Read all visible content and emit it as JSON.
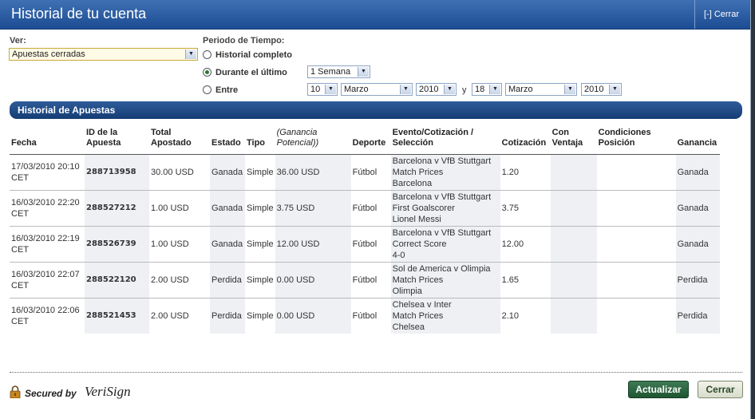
{
  "window": {
    "title": "Historial de tu cuenta",
    "close_label": "[-] Cerrar"
  },
  "filters": {
    "view_label": "Ver:",
    "view_value": "Apuestas cerradas",
    "period_label": "Periodo de Tiempo:",
    "option_all": "Historial completo",
    "option_last": "Durante el último",
    "option_last_value": "1 Semana",
    "option_between": "Entre",
    "between_from_day": "10",
    "between_from_month": "Marzo",
    "between_from_year": "2010",
    "between_and": "y",
    "between_to_day": "18",
    "between_to_month": "Marzo",
    "between_to_year": "2010",
    "selected_option": "option_last"
  },
  "section": {
    "title": "Historial de Apuestas"
  },
  "table": {
    "headers": {
      "fecha": "Fecha",
      "id_1": "ID de la",
      "id_2": "Apuesta",
      "total_1": "Total",
      "total_2": "Apostado",
      "estado": "Estado",
      "tipo": "Tipo",
      "ganancia_pot_1": "(Ganancia",
      "ganancia_pot_2": "Potencial))",
      "deporte": "Deporte",
      "evento_1": "Evento/Cotización /",
      "evento_2": "Selección",
      "cotizacion": "Cotización",
      "ventaja_1": "Con",
      "ventaja_2": "Ventaja",
      "condiciones_1": "Condiciones",
      "condiciones_2": "Posición",
      "ganancia": "Ganancia"
    },
    "rows": [
      {
        "fecha_1": "17/03/2010 20:10",
        "fecha_2": "CET",
        "id": "288713958",
        "total": "30.00 USD",
        "estado": "Ganada",
        "tipo": "Simple",
        "potencial": "36.00 USD",
        "deporte": "Fútbol",
        "evento_1": "Barcelona v VfB Stuttgart",
        "evento_2": "Match Prices",
        "evento_3": "Barcelona",
        "cotizacion": "1.20",
        "ganancia": "Ganada"
      },
      {
        "fecha_1": "16/03/2010 22:20",
        "fecha_2": "CET",
        "id": "288527212",
        "total": "1.00 USD",
        "estado": "Ganada",
        "tipo": "Simple",
        "potencial": "3.75 USD",
        "deporte": "Fútbol",
        "evento_1": "Barcelona v VfB Stuttgart",
        "evento_2": "First Goalscorer",
        "evento_3": "Lionel Messi",
        "cotizacion": "3.75",
        "ganancia": "Ganada"
      },
      {
        "fecha_1": "16/03/2010 22:19",
        "fecha_2": "CET",
        "id": "288526739",
        "total": "1.00 USD",
        "estado": "Ganada",
        "tipo": "Simple",
        "potencial": "12.00 USD",
        "deporte": "Fútbol",
        "evento_1": "Barcelona v VfB Stuttgart",
        "evento_2": "Correct Score",
        "evento_3": "4-0",
        "cotizacion": "12.00",
        "ganancia": "Ganada"
      },
      {
        "fecha_1": "16/03/2010 22:07",
        "fecha_2": "CET",
        "id": "288522120",
        "total": "2.00 USD",
        "estado": "Perdida",
        "tipo": "Simple",
        "potencial": "0.00 USD",
        "deporte": "Fútbol",
        "evento_1": "Sol de America v Olimpia",
        "evento_2": "Match Prices",
        "evento_3": "Olimpia",
        "cotizacion": "1.65",
        "ganancia": "Perdida"
      },
      {
        "fecha_1": "16/03/2010 22:06",
        "fecha_2": "CET",
        "id": "288521453",
        "total": "2.00 USD",
        "estado": "Perdida",
        "tipo": "Simple",
        "potencial": "0.00 USD",
        "deporte": "Fútbol",
        "evento_1": "Chelsea v Inter",
        "evento_2": "Match Prices",
        "evento_3": "Chelsea",
        "cotizacion": "2.10",
        "ganancia": "Perdida"
      }
    ]
  },
  "footer": {
    "secured_by": "Secured by",
    "verisign": "VeriSign",
    "refresh_label": "Actualizar",
    "close_label": "Cerrar"
  },
  "icons": {
    "lock": "lock-icon",
    "dropdown": "chevron-down-icon"
  },
  "colors": {
    "title_bar": "#1c4d93",
    "section_bar": "#153d74",
    "refresh_button": "#1f5532"
  }
}
